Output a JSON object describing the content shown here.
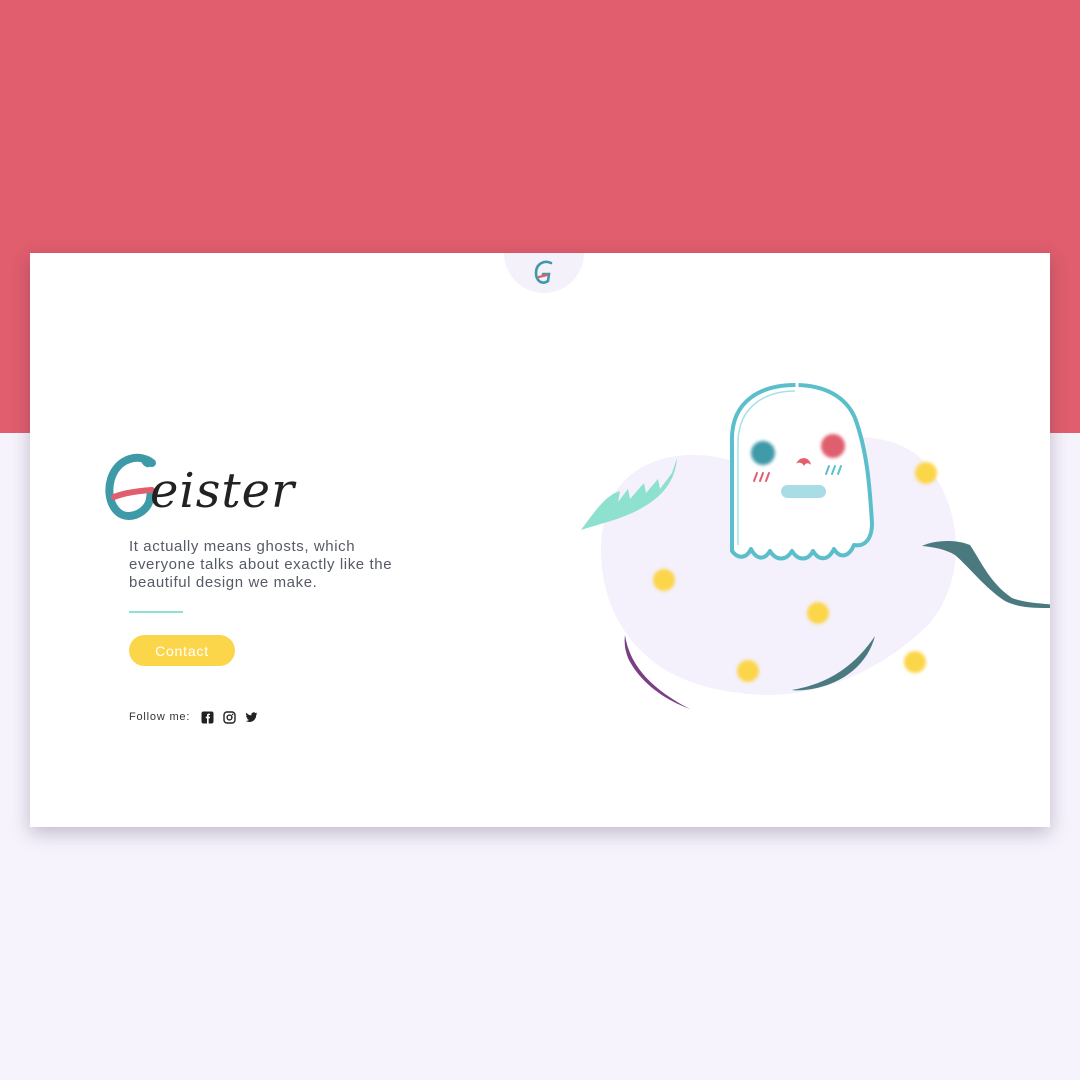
{
  "brand": {
    "initial": "G",
    "rest": "eister"
  },
  "hero": {
    "tagline": "It actually means ghosts, which everyone talks about exactly like the beautiful design we make.",
    "contact_label": "Contact"
  },
  "social": {
    "follow_label": "Follow me:",
    "icons": [
      "facebook-icon",
      "instagram-icon",
      "twitter-icon"
    ]
  },
  "colors": {
    "top_background": "#e05e6e",
    "bottom_background": "#f6f3fd",
    "brand_teal": "#3f9aa8",
    "button_yellow": "#fcd64a",
    "mint": "#8ee0cf",
    "dark_teal": "#4a7a80",
    "purple": "#7a3e85"
  }
}
